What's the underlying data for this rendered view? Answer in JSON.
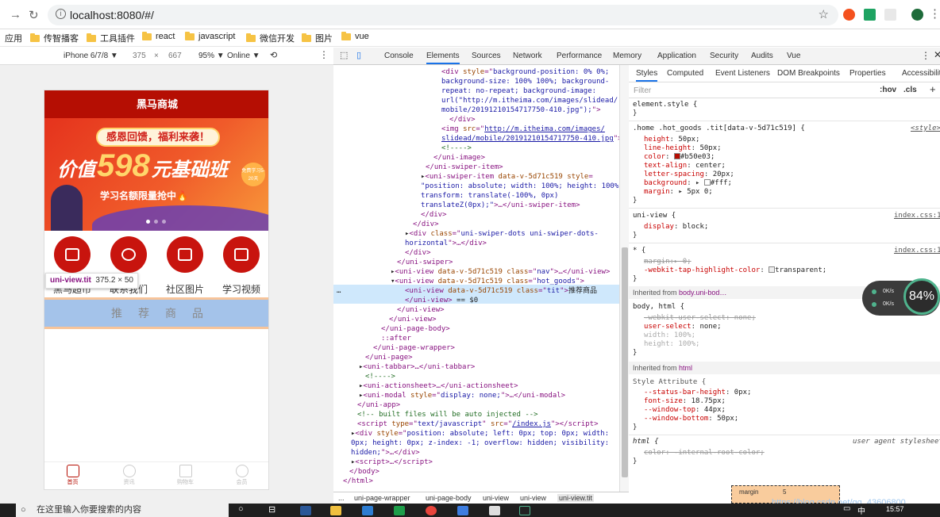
{
  "browser": {
    "url": "localhost:8080/#/",
    "bookmarks": [
      {
        "label": "应用"
      },
      {
        "label": "传智播客"
      },
      {
        "label": "工具插件"
      },
      {
        "label": "react"
      },
      {
        "label": "javascript"
      },
      {
        "label": "微信开发"
      },
      {
        "label": "图片"
      },
      {
        "label": "vue"
      }
    ]
  },
  "device_toolbar": {
    "device": "iPhone 6/7/8 ▼",
    "width": "375",
    "times": "×",
    "height": "667",
    "zoom": "95% ▼",
    "network": "Online ▼"
  },
  "app": {
    "title": "黑马商城",
    "banner": {
      "pill": "感恩回馈，福利来袭！",
      "prefix": "价值",
      "price": "598",
      "suffix": "元基础班",
      "subtitle": "学习名额限量抢中",
      "badge": "免费学习5-20天"
    },
    "nav_items": [
      "黑马超市",
      "联系我们",
      "社区图片",
      "学习视频"
    ],
    "hot_title": "推荐商品",
    "tabs": [
      "首页",
      "资讯",
      "购物车",
      "会员"
    ],
    "tooltip": {
      "tag": "uni-view.tit",
      "size": "375.2 × 50"
    }
  },
  "devtools": {
    "tabs": [
      "Console",
      "Elements",
      "Sources",
      "Network",
      "Performance",
      "Memory",
      "Application",
      "Security",
      "Audits",
      "Vue"
    ],
    "active_tab": "Elements",
    "breadcrumbs": [
      "...",
      "uni-page-wrapper",
      "uni-page-body",
      "uni-view",
      "uni-view",
      "uni-view.tit"
    ],
    "styles_tabs": [
      "Styles",
      "Computed",
      "Event Listeners",
      "DOM Breakpoints",
      "Properties",
      "Accessibility"
    ],
    "filter_placeholder": "Filter",
    "filter_hov": ":hov",
    "filter_cls": ".cls",
    "filter_add": "+"
  },
  "meter": {
    "percent": "84%",
    "up": "0K/s",
    "down": "0K/s"
  },
  "taskbar": {
    "search_placeholder": "在这里输入你要搜索的内容",
    "time": "15:57",
    "ime": "中"
  },
  "watermark": "https://blog.csdn.net/qq_43606800",
  "colors": {
    "brand": "#b50e03",
    "hot_bg": "#a4c3ea",
    "selection": "#cfe8fc"
  }
}
